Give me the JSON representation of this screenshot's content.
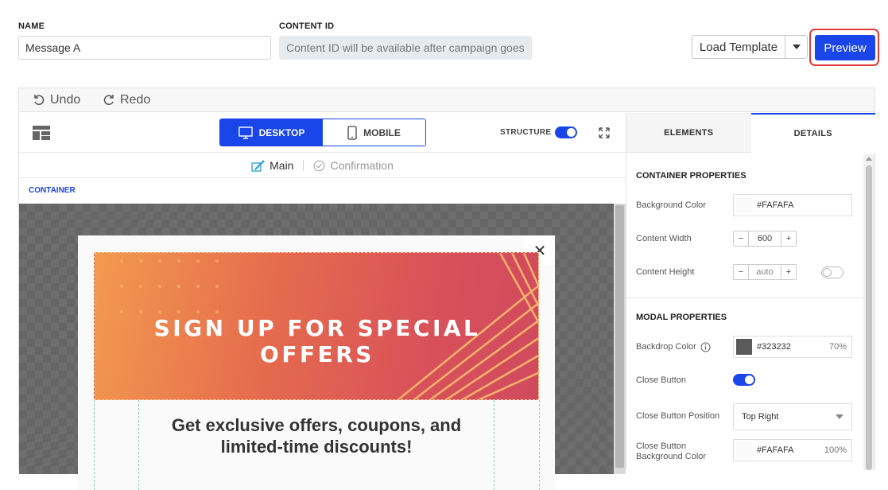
{
  "form": {
    "name_label": "NAME",
    "name_value": "Message A",
    "content_id_label": "CONTENT ID",
    "content_id_value": "Content ID will be available after campaign goes"
  },
  "actions": {
    "load_template": "Load Template",
    "preview": "Preview"
  },
  "toolbar": {
    "undo": "Undo",
    "redo": "Redo"
  },
  "view_toggle": {
    "desktop": "DESKTOP",
    "mobile": "MOBILE",
    "structure_label": "STRUCTURE"
  },
  "message_tabs": {
    "main": "Main",
    "confirmation": "Confirmation"
  },
  "breadcrumb": "CONTAINER",
  "modal": {
    "banner_title": "SIGN UP FOR SPECIAL OFFERS",
    "close_glyph": "✕",
    "body_line1": "Get exclusive offers, coupons, and",
    "body_line2": "limited-time discounts!"
  },
  "side_tabs": {
    "elements": "ELEMENTS",
    "details": "DETAILS"
  },
  "container_properties": {
    "title": "CONTAINER PROPERTIES",
    "background_color_label": "Background Color",
    "background_color_value": "#FAFAFA",
    "content_width_label": "Content Width",
    "content_width_value": "600",
    "content_height_label": "Content Height",
    "content_height_value": "auto"
  },
  "modal_properties": {
    "title": "MODAL PROPERTIES",
    "backdrop_color_label": "Backdrop Color",
    "backdrop_color_value": "#323232",
    "backdrop_opacity": "70%",
    "close_button_label": "Close Button",
    "close_button_position_label": "Close Button Position",
    "close_button_position_value": "Top Right",
    "close_button_bg_label_1": "Close Button",
    "close_button_bg_label_2": "Background Color",
    "close_button_bg_value": "#FAFAFA",
    "close_button_bg_opacity": "100%"
  },
  "stepper_glyphs": {
    "minus": "−",
    "plus": "+"
  },
  "colors": {
    "accent": "#1a45e8",
    "preview_highlight": "#e03a3a",
    "container_bg": "#FAFAFA",
    "backdrop": "#323232"
  }
}
